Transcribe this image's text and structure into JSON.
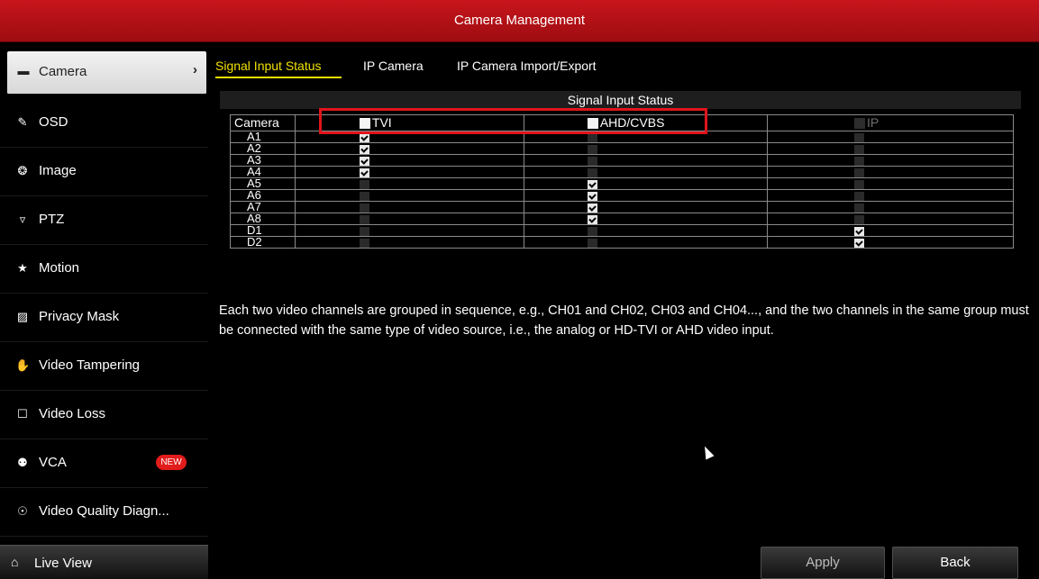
{
  "window": {
    "title": "Camera Management"
  },
  "sidebar": {
    "items": [
      {
        "label": "Camera",
        "icon": "camera-icon",
        "glyph": "▬",
        "active": true
      },
      {
        "label": "OSD",
        "icon": "osd-icon",
        "glyph": "✎"
      },
      {
        "label": "Image",
        "icon": "image-icon",
        "glyph": "❂"
      },
      {
        "label": "PTZ",
        "icon": "ptz-icon",
        "glyph": "▿"
      },
      {
        "label": "Motion",
        "icon": "motion-icon",
        "glyph": "★"
      },
      {
        "label": "Privacy Mask",
        "icon": "privacy-mask-icon",
        "glyph": "▨"
      },
      {
        "label": "Video Tampering",
        "icon": "video-tampering-icon",
        "glyph": "✋"
      },
      {
        "label": "Video Loss",
        "icon": "video-loss-icon",
        "glyph": "☐"
      },
      {
        "label": "VCA",
        "icon": "vca-icon",
        "glyph": "⚉",
        "badge": "NEW"
      },
      {
        "label": "Video Quality Diagn...",
        "icon": "video-quality-icon",
        "glyph": "☉"
      }
    ],
    "live_view": {
      "label": "Live View",
      "icon": "home-icon",
      "glyph": "⌂"
    },
    "chevron": "›"
  },
  "tabs": [
    {
      "label": "Signal Input Status",
      "active": true
    },
    {
      "label": "IP Camera"
    },
    {
      "label": "IP Camera Import/Export"
    }
  ],
  "section_title": "Signal Input Status",
  "table": {
    "columns": [
      "Camera",
      "TVI",
      "AHD/CVBS",
      "IP"
    ],
    "rows": [
      {
        "camera": "A1",
        "tvi": true,
        "ahd": false,
        "ip": false
      },
      {
        "camera": "A2",
        "tvi": true,
        "ahd": false,
        "ip": false
      },
      {
        "camera": "A3",
        "tvi": true,
        "ahd": false,
        "ip": false
      },
      {
        "camera": "A4",
        "tvi": true,
        "ahd": false,
        "ip": false
      },
      {
        "camera": "A5",
        "tvi": false,
        "ahd": true,
        "ip": false
      },
      {
        "camera": "A6",
        "tvi": false,
        "ahd": true,
        "ip": false
      },
      {
        "camera": "A7",
        "tvi": false,
        "ahd": true,
        "ip": false
      },
      {
        "camera": "A8",
        "tvi": false,
        "ahd": true,
        "ip": false
      },
      {
        "camera": "D1",
        "tvi": false,
        "ahd": false,
        "ip": true
      },
      {
        "camera": "D2",
        "tvi": false,
        "ahd": false,
        "ip": true
      }
    ]
  },
  "note": "Each two video channels are grouped in sequence, e.g., CH01 and CH02, CH03 and CH04..., and the two channels in the same group must be connected with the same type of video source, i.e., the analog or HD-TVI or AHD video input.",
  "buttons": {
    "apply": "Apply",
    "back": "Back"
  },
  "colors": {
    "title_bar": "#c8151b",
    "active_tab": "#f0e000",
    "highlight_box": "#e0141c",
    "badge": "#e21b1b"
  }
}
